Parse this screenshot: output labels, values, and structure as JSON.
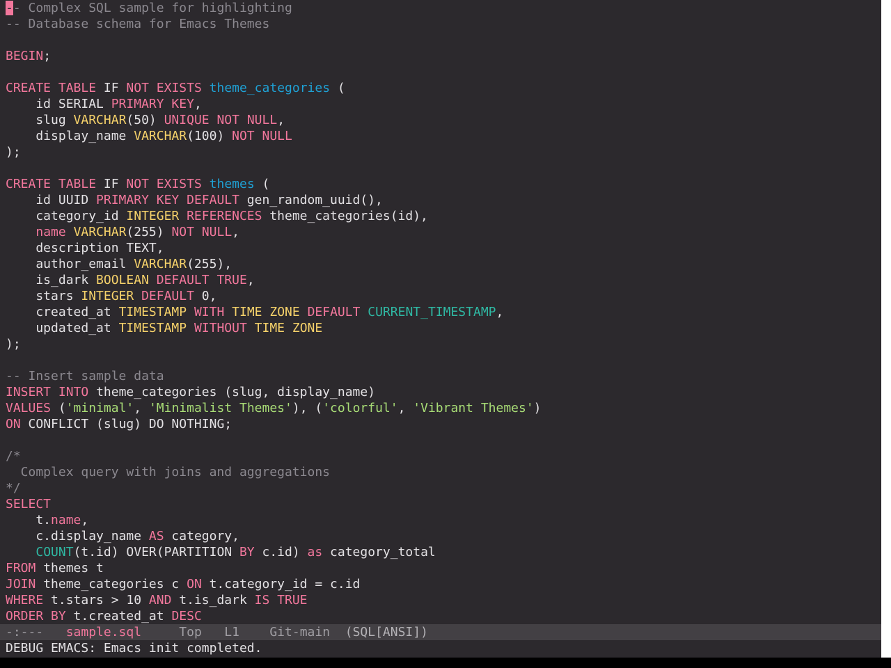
{
  "editor": {
    "lines": [
      [
        [
          "cursor",
          "-"
        ],
        [
          "comment",
          "- Complex SQL sample for highlighting"
        ]
      ],
      [
        [
          "comment",
          "-- Database schema for Emacs Themes"
        ]
      ],
      [],
      [
        [
          "keyword",
          "BEGIN"
        ],
        [
          "plain",
          ";"
        ]
      ],
      [],
      [
        [
          "keyword",
          "CREATE"
        ],
        [
          "plain",
          " "
        ],
        [
          "keyword",
          "TABLE"
        ],
        [
          "plain",
          " IF "
        ],
        [
          "keyword",
          "NOT"
        ],
        [
          "plain",
          " "
        ],
        [
          "keyword",
          "EXISTS"
        ],
        [
          "plain",
          " "
        ],
        [
          "name",
          "theme_categories"
        ],
        [
          "plain",
          " ("
        ]
      ],
      [
        [
          "plain",
          "    id SERIAL "
        ],
        [
          "keyword",
          "PRIMARY"
        ],
        [
          "plain",
          " "
        ],
        [
          "keyword",
          "KEY"
        ],
        [
          "plain",
          ","
        ]
      ],
      [
        [
          "plain",
          "    slug "
        ],
        [
          "type",
          "VARCHAR"
        ],
        [
          "plain",
          "(50) "
        ],
        [
          "keyword",
          "UNIQUE"
        ],
        [
          "plain",
          " "
        ],
        [
          "keyword",
          "NOT"
        ],
        [
          "plain",
          " "
        ],
        [
          "keyword",
          "NULL"
        ],
        [
          "plain",
          ","
        ]
      ],
      [
        [
          "plain",
          "    display_name "
        ],
        [
          "type",
          "VARCHAR"
        ],
        [
          "plain",
          "(100) "
        ],
        [
          "keyword",
          "NOT"
        ],
        [
          "plain",
          " "
        ],
        [
          "keyword",
          "NULL"
        ]
      ],
      [
        [
          "plain",
          ");"
        ]
      ],
      [],
      [
        [
          "keyword",
          "CREATE"
        ],
        [
          "plain",
          " "
        ],
        [
          "keyword",
          "TABLE"
        ],
        [
          "plain",
          " IF "
        ],
        [
          "keyword",
          "NOT"
        ],
        [
          "plain",
          " "
        ],
        [
          "keyword",
          "EXISTS"
        ],
        [
          "plain",
          " "
        ],
        [
          "name",
          "themes"
        ],
        [
          "plain",
          " ("
        ]
      ],
      [
        [
          "plain",
          "    id UUID "
        ],
        [
          "keyword",
          "PRIMARY"
        ],
        [
          "plain",
          " "
        ],
        [
          "keyword",
          "KEY"
        ],
        [
          "plain",
          " "
        ],
        [
          "keyword",
          "DEFAULT"
        ],
        [
          "plain",
          " gen_random_uuid(),"
        ]
      ],
      [
        [
          "plain",
          "    category_id "
        ],
        [
          "type",
          "INTEGER"
        ],
        [
          "plain",
          " "
        ],
        [
          "keyword",
          "REFERENCES"
        ],
        [
          "plain",
          " theme_categories(id),"
        ]
      ],
      [
        [
          "plain",
          "    "
        ],
        [
          "prop",
          "name"
        ],
        [
          "plain",
          " "
        ],
        [
          "type",
          "VARCHAR"
        ],
        [
          "plain",
          "(255) "
        ],
        [
          "keyword",
          "NOT"
        ],
        [
          "plain",
          " "
        ],
        [
          "keyword",
          "NULL"
        ],
        [
          "plain",
          ","
        ]
      ],
      [
        [
          "plain",
          "    description TEXT,"
        ]
      ],
      [
        [
          "plain",
          "    author_email "
        ],
        [
          "type",
          "VARCHAR"
        ],
        [
          "plain",
          "(255),"
        ]
      ],
      [
        [
          "plain",
          "    is_dark "
        ],
        [
          "type",
          "BOOLEAN"
        ],
        [
          "plain",
          " "
        ],
        [
          "keyword",
          "DEFAULT"
        ],
        [
          "plain",
          " "
        ],
        [
          "keyword",
          "TRUE"
        ],
        [
          "plain",
          ","
        ]
      ],
      [
        [
          "plain",
          "    stars "
        ],
        [
          "type",
          "INTEGER"
        ],
        [
          "plain",
          " "
        ],
        [
          "keyword",
          "DEFAULT"
        ],
        [
          "plain",
          " 0,"
        ]
      ],
      [
        [
          "plain",
          "    created_at "
        ],
        [
          "type",
          "TIMESTAMP"
        ],
        [
          "plain",
          " "
        ],
        [
          "keyword",
          "WITH"
        ],
        [
          "plain",
          " "
        ],
        [
          "type",
          "TIME"
        ],
        [
          "plain",
          " "
        ],
        [
          "type",
          "ZONE"
        ],
        [
          "plain",
          " "
        ],
        [
          "keyword",
          "DEFAULT"
        ],
        [
          "plain",
          " "
        ],
        [
          "builtin",
          "CURRENT_TIMESTAMP"
        ],
        [
          "plain",
          ","
        ]
      ],
      [
        [
          "plain",
          "    updated_at "
        ],
        [
          "type",
          "TIMESTAMP"
        ],
        [
          "plain",
          " "
        ],
        [
          "keyword",
          "WITHOUT"
        ],
        [
          "plain",
          " "
        ],
        [
          "type",
          "TIME"
        ],
        [
          "plain",
          " "
        ],
        [
          "type",
          "ZONE"
        ]
      ],
      [
        [
          "plain",
          ");"
        ]
      ],
      [],
      [
        [
          "comment",
          "-- Insert sample data"
        ]
      ],
      [
        [
          "keyword",
          "INSERT"
        ],
        [
          "plain",
          " "
        ],
        [
          "keyword",
          "INTO"
        ],
        [
          "plain",
          " theme_categories (slug, display_name)"
        ]
      ],
      [
        [
          "keyword",
          "VALUES"
        ],
        [
          "plain",
          " ("
        ],
        [
          "string",
          "'minimal'"
        ],
        [
          "plain",
          ", "
        ],
        [
          "string",
          "'Minimalist Themes'"
        ],
        [
          "plain",
          "), ("
        ],
        [
          "string",
          "'colorful'"
        ],
        [
          "plain",
          ", "
        ],
        [
          "string",
          "'Vibrant Themes'"
        ],
        [
          "plain",
          ")"
        ]
      ],
      [
        [
          "keyword",
          "ON"
        ],
        [
          "plain",
          " CONFLICT (slug) DO NOTHING;"
        ]
      ],
      [],
      [
        [
          "comment",
          "/*"
        ]
      ],
      [
        [
          "comment",
          "  Complex query with joins and aggregations"
        ]
      ],
      [
        [
          "comment",
          "*/"
        ]
      ],
      [
        [
          "keyword",
          "SELECT"
        ]
      ],
      [
        [
          "plain",
          "    t."
        ],
        [
          "prop",
          "name"
        ],
        [
          "plain",
          ","
        ]
      ],
      [
        [
          "plain",
          "    c.display_name "
        ],
        [
          "keyword",
          "AS"
        ],
        [
          "plain",
          " category,"
        ]
      ],
      [
        [
          "plain",
          "    "
        ],
        [
          "builtin",
          "COUNT"
        ],
        [
          "plain",
          "(t.id) OVER(PARTITION "
        ],
        [
          "keyword",
          "BY"
        ],
        [
          "plain",
          " c.id) "
        ],
        [
          "keyword",
          "as"
        ],
        [
          "plain",
          " category_total"
        ]
      ],
      [
        [
          "keyword",
          "FROM"
        ],
        [
          "plain",
          " themes t"
        ]
      ],
      [
        [
          "keyword",
          "JOIN"
        ],
        [
          "plain",
          " theme_categories c "
        ],
        [
          "keyword",
          "ON"
        ],
        [
          "plain",
          " t.category_id = c.id"
        ]
      ],
      [
        [
          "keyword",
          "WHERE"
        ],
        [
          "plain",
          " t.stars > 10 "
        ],
        [
          "keyword",
          "AND"
        ],
        [
          "plain",
          " t.is_dark "
        ],
        [
          "keyword",
          "IS"
        ],
        [
          "plain",
          " "
        ],
        [
          "keyword",
          "TRUE"
        ]
      ],
      [
        [
          "keyword",
          "ORDER"
        ],
        [
          "plain",
          " "
        ],
        [
          "keyword",
          "BY"
        ],
        [
          "plain",
          " t.created_at "
        ],
        [
          "keyword",
          "DESC"
        ]
      ]
    ]
  },
  "modeline": {
    "status": "-:---",
    "buffer_name": "sample.sql",
    "position": "Top",
    "line": "L1",
    "vc": "Git-main",
    "mode": "(SQL[ANSI])"
  },
  "echo_area": {
    "message": "DEBUG EMACS: Emacs init completed."
  },
  "colors": {
    "background": "#2c292d",
    "foreground": "#e3e1e4",
    "keyword": "#f2779c",
    "type": "#f5d16a",
    "table_name": "#1fa1d5",
    "builtin": "#2fb8a3",
    "string": "#a8dc76",
    "comment": "#8b888f",
    "modeline_bg": "#434044"
  }
}
